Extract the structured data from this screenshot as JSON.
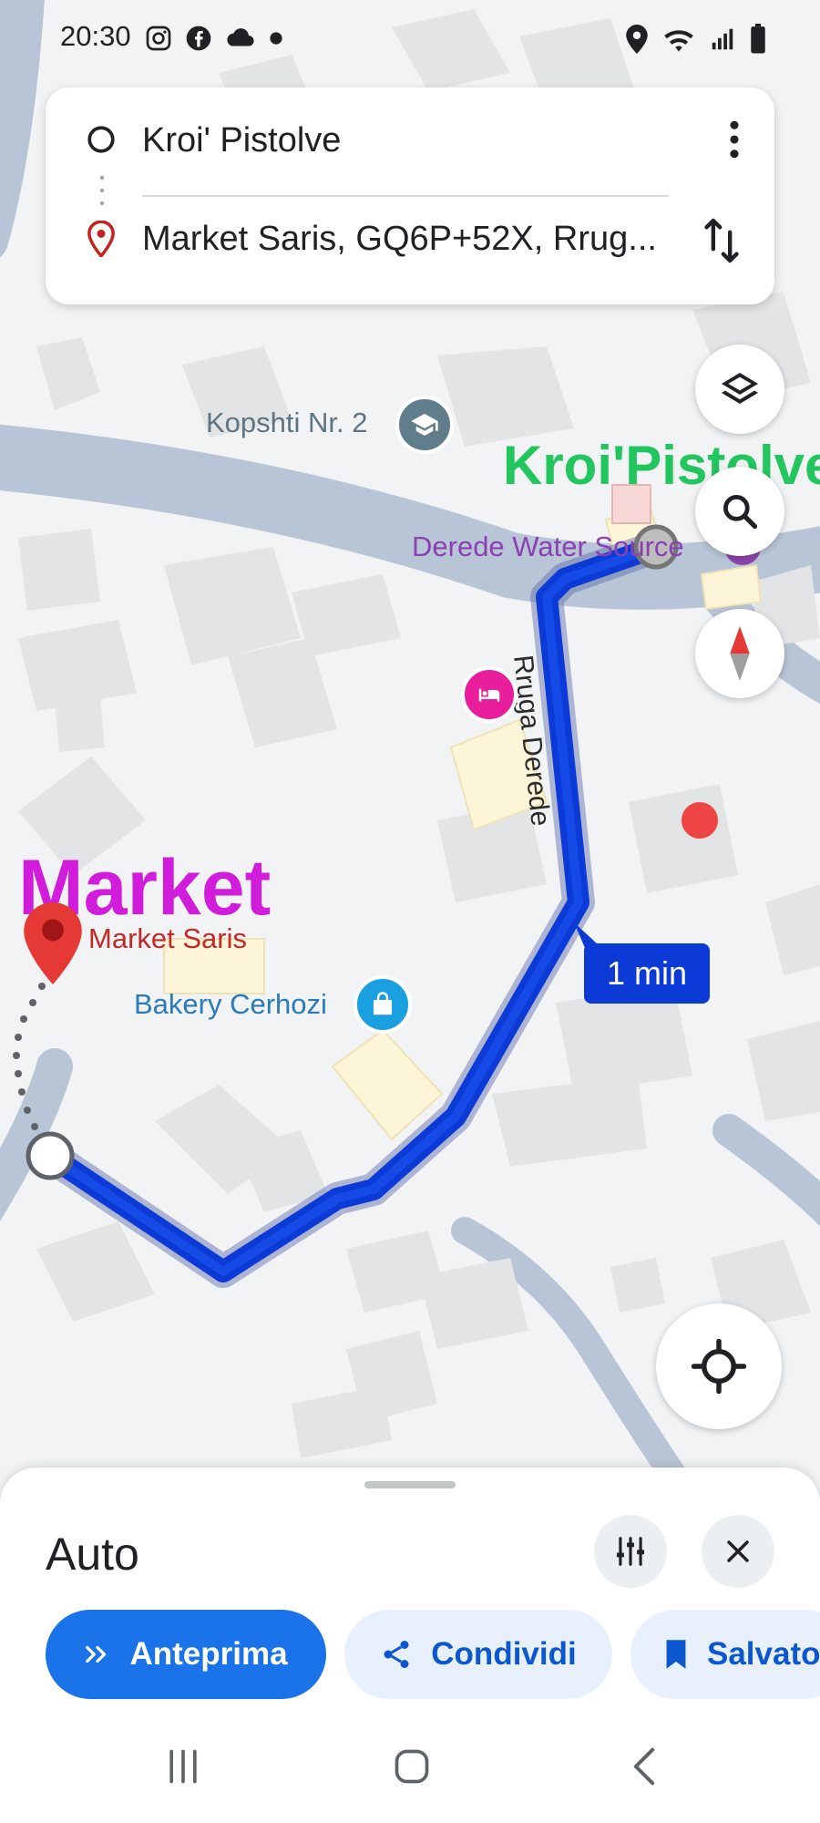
{
  "status_bar": {
    "time": "20:30",
    "left_icons": [
      "instagram-icon",
      "facebook-icon",
      "cloud-icon",
      "dot-icon"
    ],
    "right_icons": [
      "location-icon",
      "wifi-icon",
      "signal-icon",
      "battery-icon"
    ]
  },
  "directions": {
    "origin": "Kroi' Pistolve",
    "destination": "Market Saris, GQ6P+52X, Rrug..."
  },
  "map": {
    "labels": {
      "kindergarten": "Kopshti Nr. 2",
      "origin_overlay": "Kroi'Pistolve",
      "water_source": "Derede Water Source",
      "street": "Rruga Derede",
      "destination_overlay": "Market",
      "destination_pin": "Market Saris",
      "bakery": "Bakery Cerhozi"
    },
    "eta": "1 min",
    "route_color": "#0b3ad6",
    "origin_overlay_color": "#22c55e",
    "destination_overlay_color": "#d11ddb"
  },
  "sheet": {
    "mode": "Auto",
    "chips": {
      "preview": "Anteprima",
      "share": "Condividi",
      "save": "Salvato"
    }
  }
}
